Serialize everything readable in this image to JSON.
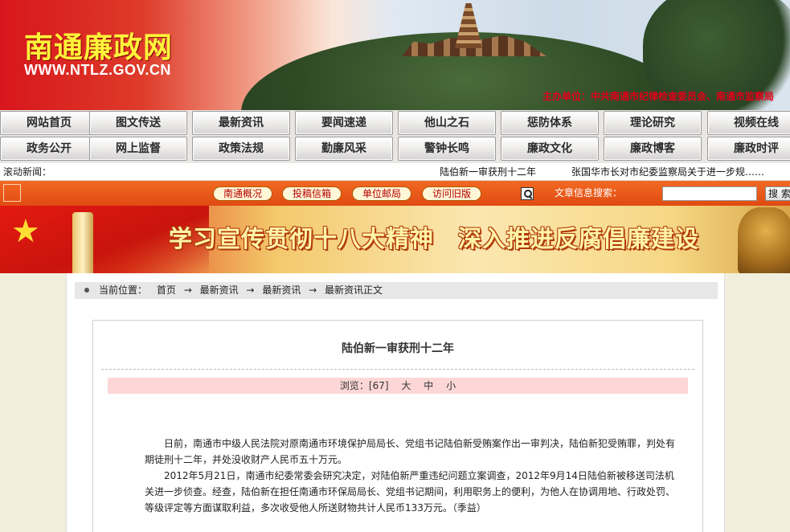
{
  "header": {
    "title": "南通廉政网",
    "url": "WWW.NTLZ.GOV.CN",
    "sponsor": "主办单位：中共南通市纪律检查委员会、南通市监察局"
  },
  "nav": {
    "row1": [
      "网站首页",
      "图文传送",
      "最新资讯",
      "要闻速递",
      "他山之石",
      "惩防体系",
      "理论研究",
      "视频在线"
    ],
    "row2": [
      "政务公开",
      "网上监督",
      "政策法规",
      "勤廉风采",
      "警钟长鸣",
      "廉政文化",
      "廉政博客",
      "廉政时评"
    ]
  },
  "ticker": {
    "label": "滚动新闻：",
    "items": [
      "陆伯新一审获刑十二年",
      "张国华市长对市纪委监察局关于进一步规……"
    ]
  },
  "toolbar": {
    "pills": [
      "南通概况",
      "投稿信箱",
      "单位邮局",
      "访问旧版"
    ],
    "search_label": "文章信息搜索：",
    "search_button": "搜 索",
    "search_value": ""
  },
  "banner": {
    "slogan": "学习宣传贯彻十八大精神　深入推进反腐倡廉建设"
  },
  "breadcrumb": {
    "prefix": "当前位置：",
    "items": [
      "首页",
      "最新资讯",
      "最新资讯",
      "最新资讯正文"
    ],
    "separator": "→"
  },
  "article": {
    "title": "陆伯新一审获刑十二年",
    "views_label": "浏览：[67]",
    "font_sizes": [
      "大",
      "中",
      "小"
    ],
    "paragraphs": [
      "日前，南通市中级人民法院对原南通市环境保护局局长、党组书记陆伯新受贿案作出一审判决，陆伯新犯受贿罪，判处有期徒刑十二年，并处没收财产人民币五十万元。",
      "2012年5月21日，南通市纪委常委会研究决定，对陆伯新严重违纪问题立案调查，2012年9月14日陆伯新被移送司法机关进一步侦查。经查，陆伯新在担任南通市环保局局长、党组书记期间，利用职务上的便利，为他人在协调用地、行政处罚、等级评定等方面谋取利益，多次收受他人所送财物共计人民币133万元。（季益）"
    ]
  }
}
